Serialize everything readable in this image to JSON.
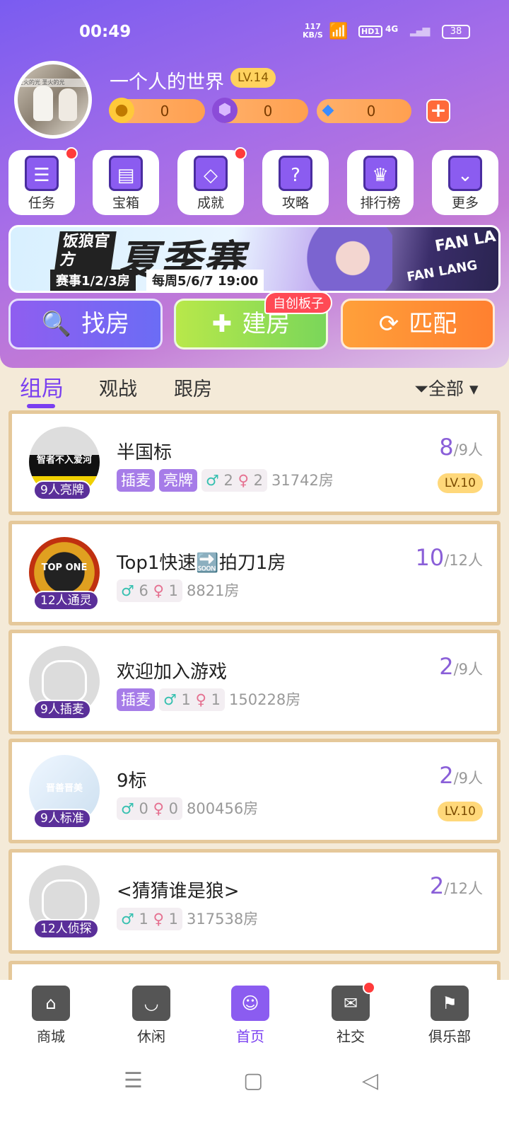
{
  "status": {
    "time": "00:49",
    "net_rate": "117",
    "net_unit": "KB/S",
    "hd": "HD1",
    "signal": "4G",
    "battery": "38"
  },
  "profile": {
    "name": "一个人的世界",
    "level": "LV.14",
    "avatar_text": "圣火的光 圣火的光",
    "coins": "0",
    "gems": "0",
    "diamonds": "0"
  },
  "quick_actions": [
    {
      "label": "任务",
      "icon": "task-icon",
      "glyph": "☰",
      "dot": true
    },
    {
      "label": "宝箱",
      "icon": "chest-icon",
      "glyph": "▤",
      "dot": false
    },
    {
      "label": "成就",
      "icon": "achievement-banner-icon",
      "glyph": "◇",
      "dot": true
    },
    {
      "label": "攻略",
      "icon": "guide-book-icon",
      "glyph": "?",
      "dot": false
    },
    {
      "label": "排行榜",
      "icon": "trophy-icon",
      "glyph": "♛",
      "dot": false
    },
    {
      "label": "更多",
      "icon": "more-chevron-icon",
      "glyph": "⌄",
      "dot": false
    }
  ],
  "banner": {
    "brand": "饭狼官方",
    "title": "夏季赛",
    "schedule": "赛事1/2/3房",
    "time": "每周5/6/7 19:00",
    "en1": "FAN LA",
    "en2": "FAN LANG"
  },
  "actions": {
    "find": "找房",
    "build": "建房",
    "match": "匹配",
    "custom_tag": "自创板子"
  },
  "tabs": {
    "group": "组局",
    "watch": "观战",
    "follow": "跟房",
    "filter": "全部"
  },
  "rooms": [
    {
      "title": "半国标",
      "badge": "9人亮牌",
      "tags": [
        "插麦",
        "亮牌"
      ],
      "male": "2",
      "female": "2",
      "room_no": "31742房",
      "current": "8",
      "capacity": "/9人",
      "level": "LV.10",
      "thumb_text": "智者不入爱河"
    },
    {
      "title": "Top1快速🔜拍刀1房",
      "badge": "12人通灵",
      "tags": [],
      "male": "6",
      "female": "1",
      "room_no": "8821房",
      "current": "10",
      "capacity": "/12人",
      "level": "",
      "thumb_text": "TOP ONE"
    },
    {
      "title": "欢迎加入游戏",
      "badge": "9人插麦",
      "tags": [
        "插麦"
      ],
      "male": "1",
      "female": "1",
      "room_no": "150228房",
      "current": "2",
      "capacity": "/9人",
      "level": "",
      "thumb_text": ""
    },
    {
      "title": "9标",
      "badge": "9人标准",
      "tags": [],
      "male": "0",
      "female": "0",
      "room_no": "800456房",
      "current": "2",
      "capacity": "/9人",
      "level": "LV.10",
      "thumb_text": "晋善晋美"
    },
    {
      "title": "<猜猜谁是狼>",
      "badge": "12人侦探",
      "tags": [],
      "male": "1",
      "female": "1",
      "room_no": "317538房",
      "current": "2",
      "capacity": "/12人",
      "level": "",
      "thumb_text": ""
    }
  ],
  "nav": [
    {
      "label": "商城",
      "icon": "shop-icon",
      "glyph": "⌂",
      "dot": false,
      "active": false
    },
    {
      "label": "休闲",
      "icon": "cup-icon",
      "glyph": "◡",
      "dot": false,
      "active": false
    },
    {
      "label": "首页",
      "icon": "home-cards-icon",
      "glyph": "☺",
      "dot": false,
      "active": true
    },
    {
      "label": "社交",
      "icon": "chat-icon",
      "glyph": "✉",
      "dot": true,
      "active": false
    },
    {
      "label": "俱乐部",
      "icon": "club-flag-icon",
      "glyph": "⚑",
      "dot": false,
      "active": false
    }
  ],
  "colors": {
    "accent": "#7a3ff0",
    "card_border": "#e5c89a",
    "bg": "#f4ead8"
  }
}
